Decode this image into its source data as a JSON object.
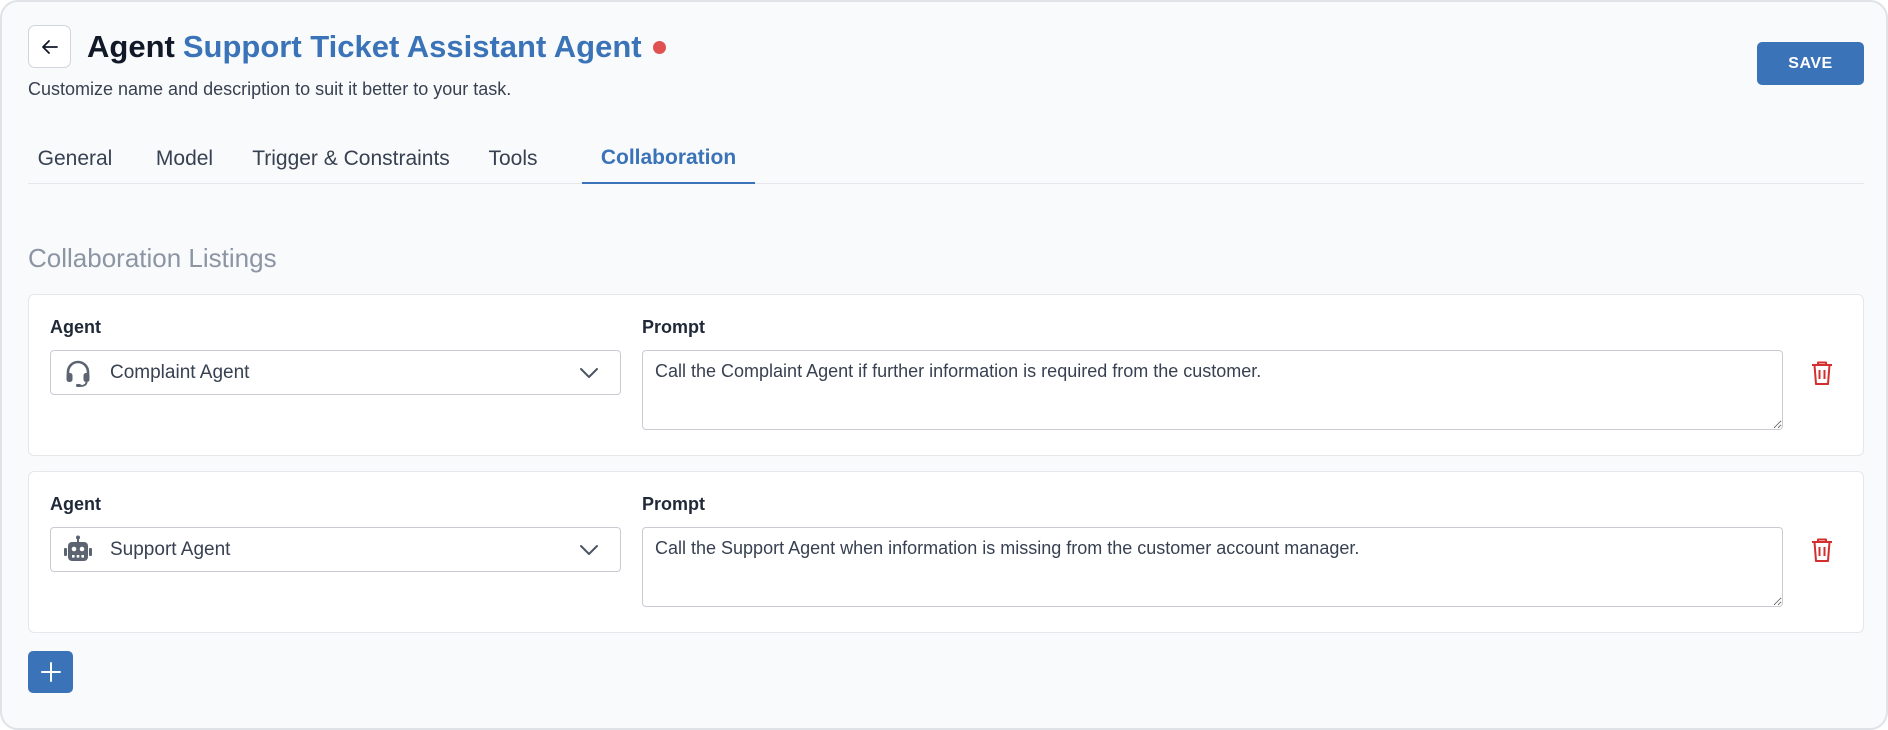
{
  "header": {
    "title_prefix": "Agent",
    "agent_name": "Support Ticket Assistant Agent",
    "subtitle": "Customize name and description to suit it better to your task.",
    "save_label": "SAVE"
  },
  "tabs": [
    {
      "label": "General",
      "active": false
    },
    {
      "label": "Model",
      "active": false
    },
    {
      "label": "Trigger & Constraints",
      "active": false
    },
    {
      "label": "Tools",
      "active": false
    },
    {
      "label": "Collaboration",
      "active": true
    }
  ],
  "collaboration": {
    "section_title": "Collaboration Listings",
    "agent_label": "Agent",
    "prompt_label": "Prompt",
    "rows": [
      {
        "agent": "Complaint Agent",
        "agent_icon": "headset-icon",
        "prompt": "Call the Complaint Agent if further information is required from the customer."
      },
      {
        "agent": "Support Agent",
        "agent_icon": "robot-icon",
        "prompt": "Call the Support Agent when information is missing from the customer account manager."
      }
    ]
  },
  "colors": {
    "accent": "#3a73b8",
    "unsaved_dot": "#e05252",
    "delete": "#d32f2f"
  }
}
